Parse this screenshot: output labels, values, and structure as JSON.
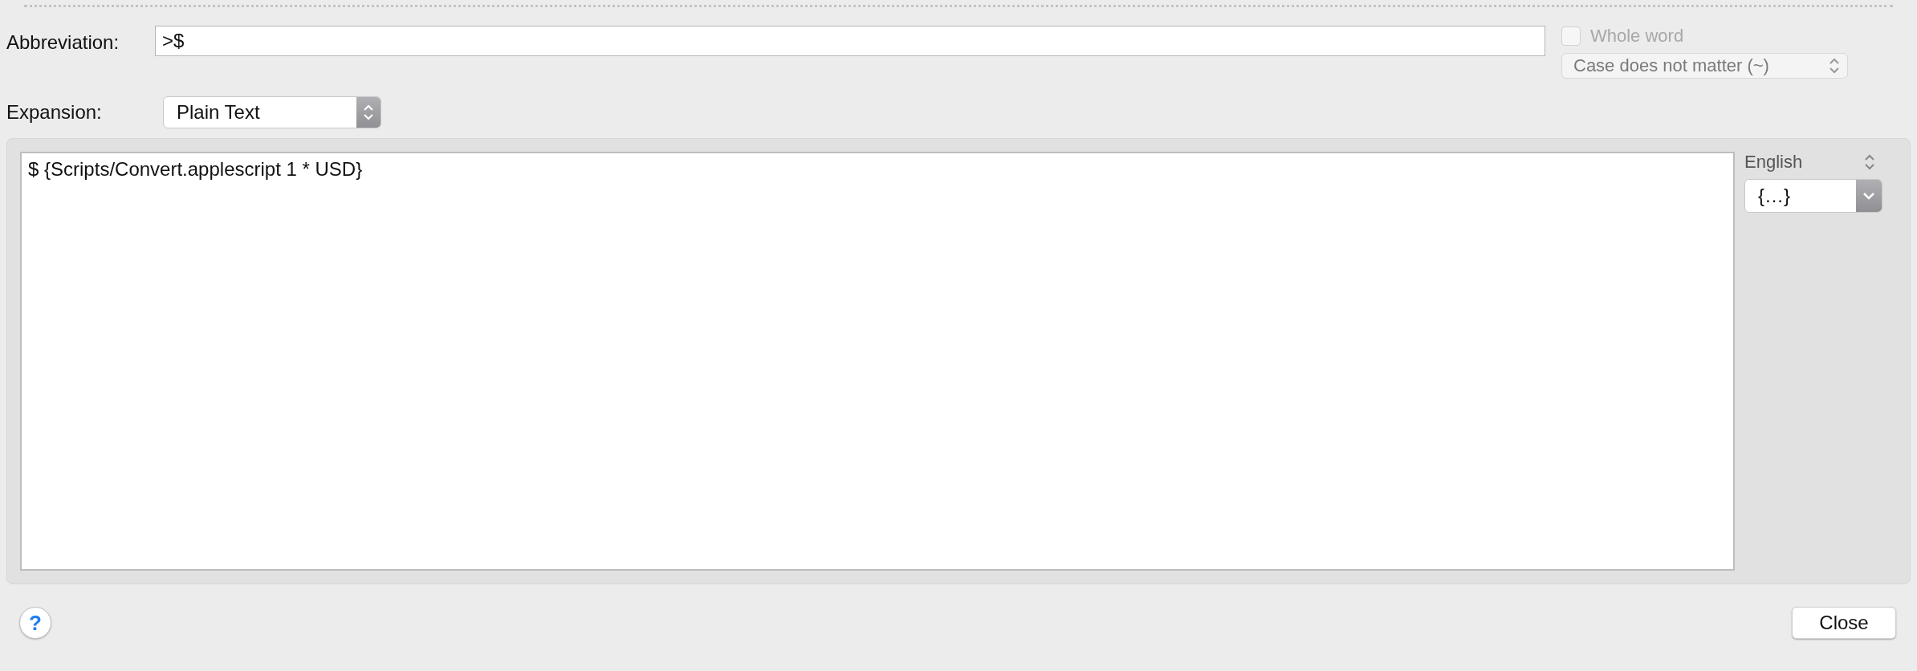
{
  "abbreviation": {
    "label": "Abbreviation:",
    "value": ">$"
  },
  "whole_word": {
    "label": "Whole word",
    "checked": false,
    "disabled": true
  },
  "case_popup": {
    "value": "Case does not matter (~)",
    "disabled": true
  },
  "expansion": {
    "label": "Expansion:",
    "value": "Plain Text"
  },
  "editor": {
    "value": "$ {Scripts/Convert.applescript 1 * USD}"
  },
  "language": {
    "value": "English"
  },
  "snippet_popup": {
    "value": "{…}"
  },
  "buttons": {
    "help": "?",
    "close": "Close"
  }
}
